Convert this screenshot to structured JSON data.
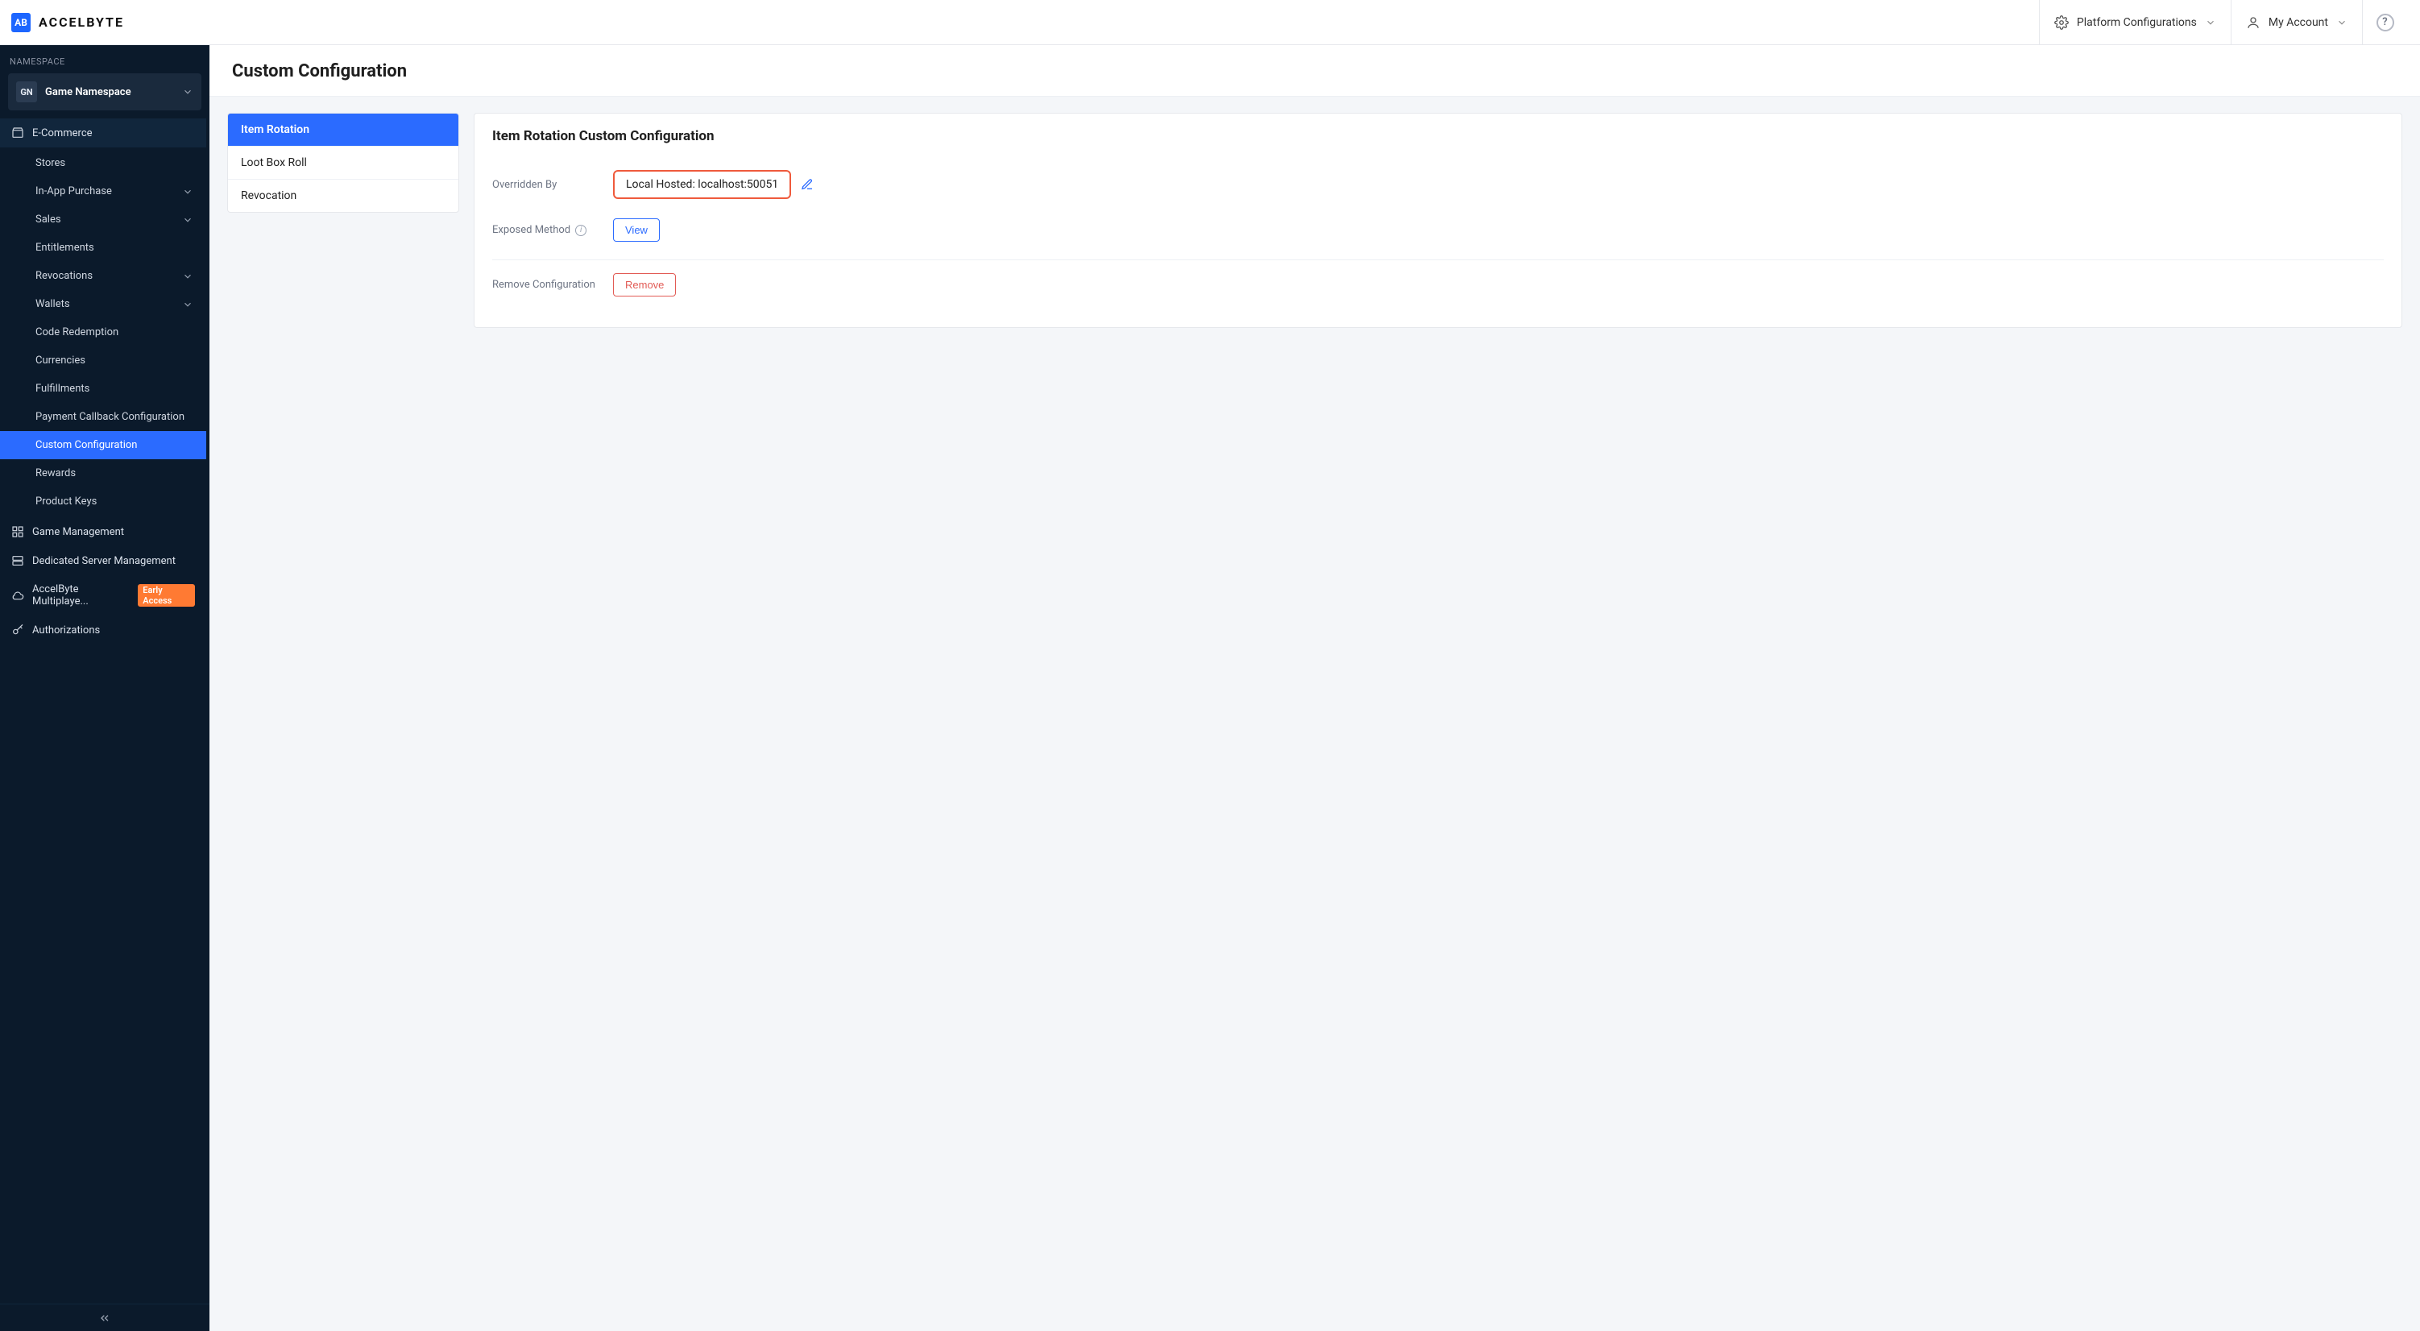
{
  "brand": {
    "mark": "AB",
    "name": "ACCELBYTE"
  },
  "topbar": {
    "platform_config_label": "Platform Configurations",
    "my_account_label": "My Account"
  },
  "sidebar": {
    "namespace_label": "NAMESPACE",
    "namespace_badge": "GN",
    "namespace_name": "Game Namespace",
    "sections": {
      "ecommerce_label": "E-Commerce",
      "game_mgmt_label": "Game Management",
      "dsm_label": "Dedicated Server Management",
      "multiplayer_label": "AccelByte Multiplaye...",
      "multiplayer_badge": "Early Access",
      "authorizations_label": "Authorizations"
    },
    "ecommerce_items": [
      {
        "label": "Stores"
      },
      {
        "label": "In-App Purchase",
        "caret": true
      },
      {
        "label": "Sales",
        "caret": true
      },
      {
        "label": "Entitlements"
      },
      {
        "label": "Revocations",
        "caret": true
      },
      {
        "label": "Wallets",
        "caret": true
      },
      {
        "label": "Code Redemption"
      },
      {
        "label": "Currencies"
      },
      {
        "label": "Fulfillments"
      },
      {
        "label": "Payment Callback Configuration"
      },
      {
        "label": "Custom Configuration",
        "active": true
      },
      {
        "label": "Rewards"
      },
      {
        "label": "Product Keys"
      }
    ]
  },
  "page": {
    "title": "Custom Configuration",
    "tabs": [
      {
        "label": "Item Rotation",
        "active": true
      },
      {
        "label": "Loot Box Roll"
      },
      {
        "label": "Revocation"
      }
    ],
    "panel": {
      "title": "Item Rotation Custom Configuration",
      "overridden_by_label": "Overridden By",
      "overridden_by_value": "Local Hosted: localhost:50051",
      "exposed_method_label": "Exposed Method",
      "view_button": "View",
      "remove_config_label": "Remove Configuration",
      "remove_button": "Remove"
    }
  }
}
